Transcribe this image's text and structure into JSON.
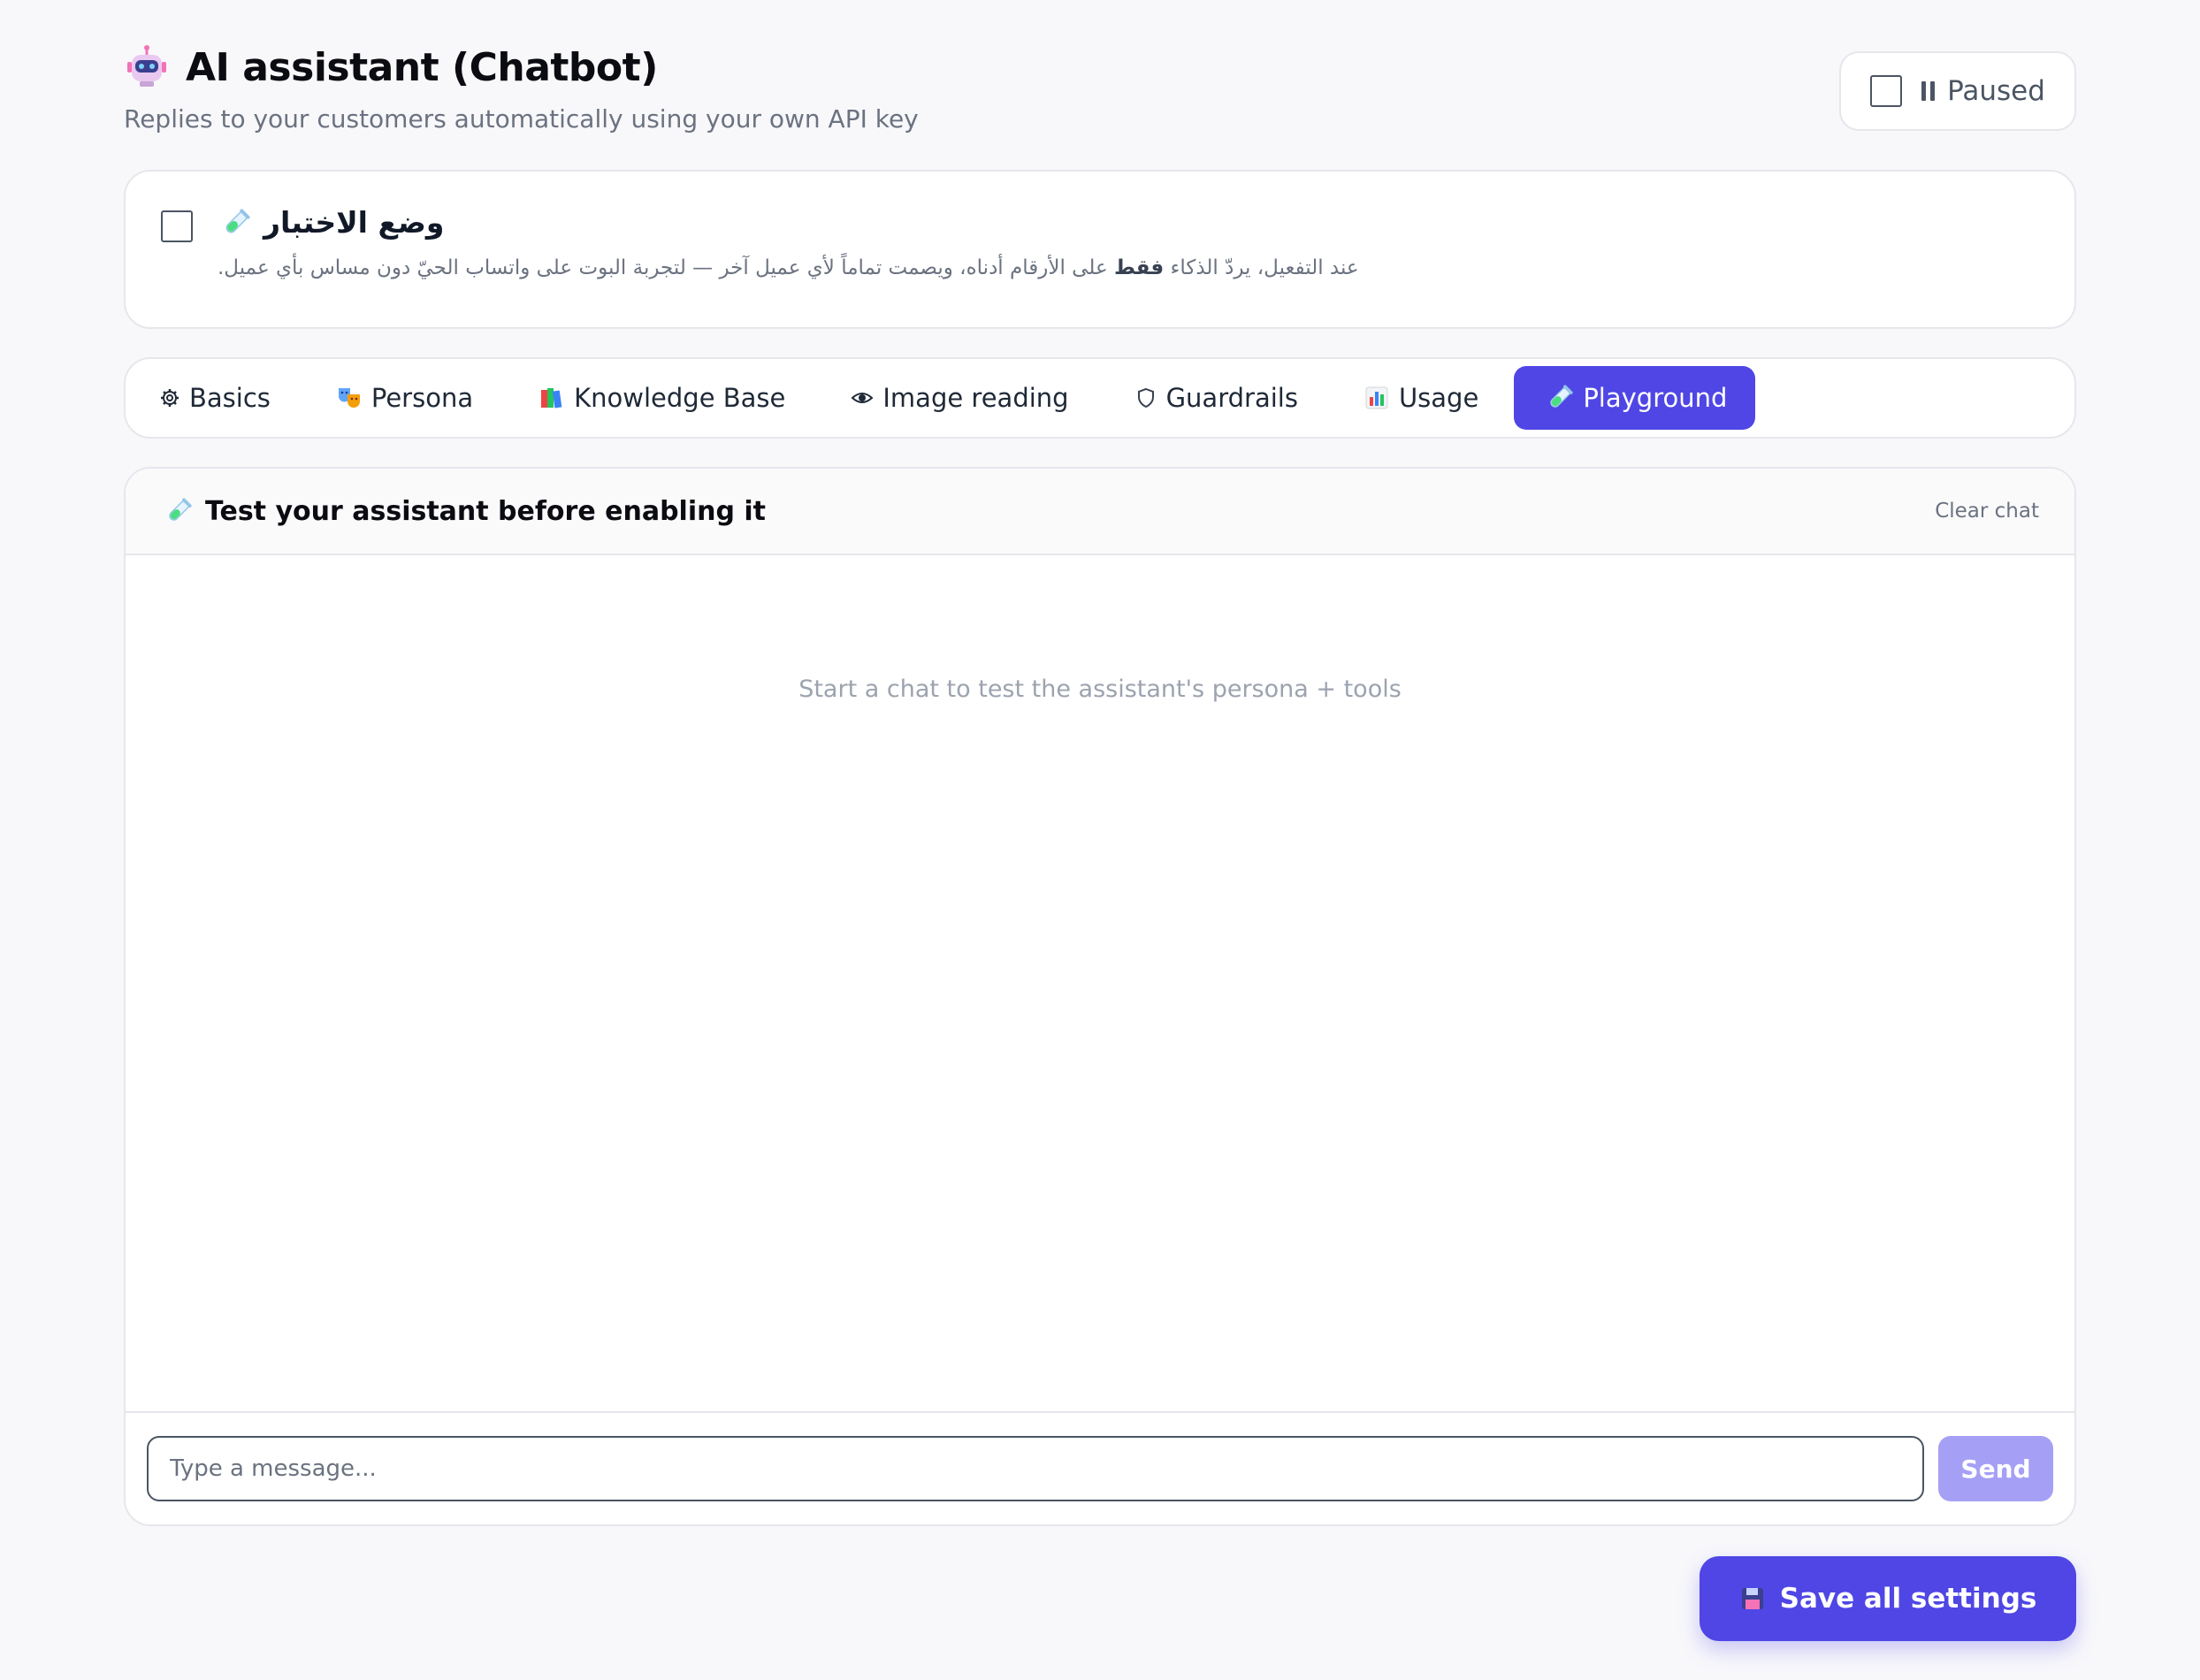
{
  "header": {
    "title": "AI assistant (Chatbot)",
    "subtitle": "Replies to your customers automatically using your own API key",
    "icon": "robot-icon",
    "paused_label": "Paused"
  },
  "test_mode": {
    "title": "وضع الاختبار",
    "description_before": "عند التفعيل، يردّ الذكاء ",
    "description_emphasis": "فقط",
    "description_after": " على الأرقام أدناه، ويصمت تماماً لأي عميل آخر — لتجربة البوت على واتساب الحيّ دون مساس بأي عميل.",
    "icon": "test-tube-icon"
  },
  "tabs": [
    {
      "label": "Basics",
      "icon": "gear-icon"
    },
    {
      "label": "Persona",
      "icon": "theater-masks-icon"
    },
    {
      "label": "Knowledge Base",
      "icon": "books-icon"
    },
    {
      "label": "Image reading",
      "icon": "eye-icon"
    },
    {
      "label": "Guardrails",
      "icon": "shield-icon"
    },
    {
      "label": "Usage",
      "icon": "bar-chart-icon"
    },
    {
      "label": "Playground",
      "icon": "test-tube-icon",
      "active": true
    }
  ],
  "playground": {
    "title": "Test your assistant before enabling it",
    "clear_label": "Clear chat",
    "empty_text": "Start a chat to test the assistant's persona + tools",
    "input_placeholder": "Type a message...",
    "send_label": "Send"
  },
  "save_label": "Save all settings",
  "colors": {
    "accent": "#4f46e5",
    "send_disabled": "#a5a0f5",
    "background": "#f8f8fb",
    "border": "#e5e7eb"
  }
}
